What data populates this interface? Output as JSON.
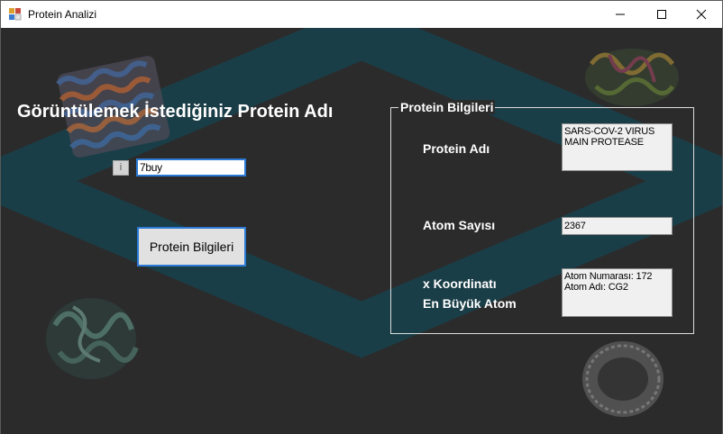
{
  "window": {
    "title": "Protein Analizi"
  },
  "main": {
    "heading": "Görüntülemek İstediğiniz Protein Adı",
    "info_button": "i",
    "input_value": "7buy",
    "submit_label": "Protein Bilgileri"
  },
  "group": {
    "title": "Protein Bilgileri",
    "name_label": "Protein Adı",
    "name_value_lines": [
      "SARS-COV-2 VIRUS",
      "MAIN PROTEASE"
    ],
    "atom_count_label": "Atom Sayısı",
    "atom_count_value": "2367",
    "coord_label_1": "x Koordinatı",
    "coord_label_2": "En Büyük Atom",
    "coord_value_lines": [
      "Atom Numarası: 172",
      "Atom Adı: CG2"
    ]
  },
  "colors": {
    "background": "#2b2b2c",
    "accent_frame": "#17424c",
    "focus_border": "#2c7ad6"
  }
}
